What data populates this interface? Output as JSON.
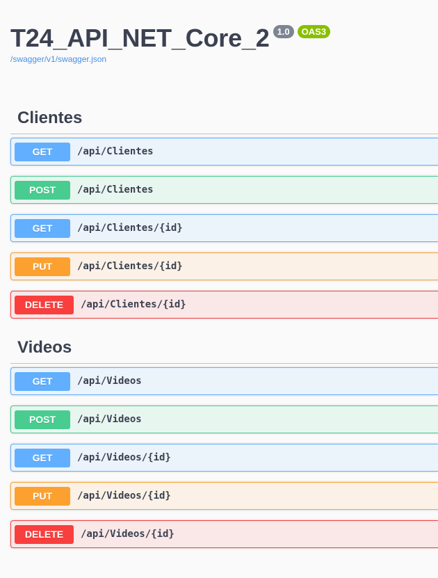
{
  "info": {
    "title": "T24_API_NET_Core_2",
    "version_badge": "1.0",
    "oas_badge": "OAS3",
    "spec_link": "/swagger/v1/swagger.json"
  },
  "tags": [
    {
      "name": "Clientes",
      "operations": [
        {
          "method": "GET",
          "path": "/api/Clientes"
        },
        {
          "method": "POST",
          "path": "/api/Clientes"
        },
        {
          "method": "GET",
          "path": "/api/Clientes/{id}"
        },
        {
          "method": "PUT",
          "path": "/api/Clientes/{id}"
        },
        {
          "method": "DELETE",
          "path": "/api/Clientes/{id}"
        }
      ]
    },
    {
      "name": "Videos",
      "operations": [
        {
          "method": "GET",
          "path": "/api/Videos"
        },
        {
          "method": "POST",
          "path": "/api/Videos"
        },
        {
          "method": "GET",
          "path": "/api/Videos/{id}"
        },
        {
          "method": "PUT",
          "path": "/api/Videos/{id}"
        },
        {
          "method": "DELETE",
          "path": "/api/Videos/{id}"
        }
      ]
    }
  ],
  "colors": {
    "GET": "#61affe",
    "POST": "#49cc90",
    "PUT": "#fca130",
    "DELETE": "#f93e3e",
    "version_badge": "#7d8492",
    "oas_badge": "#89bf04"
  }
}
